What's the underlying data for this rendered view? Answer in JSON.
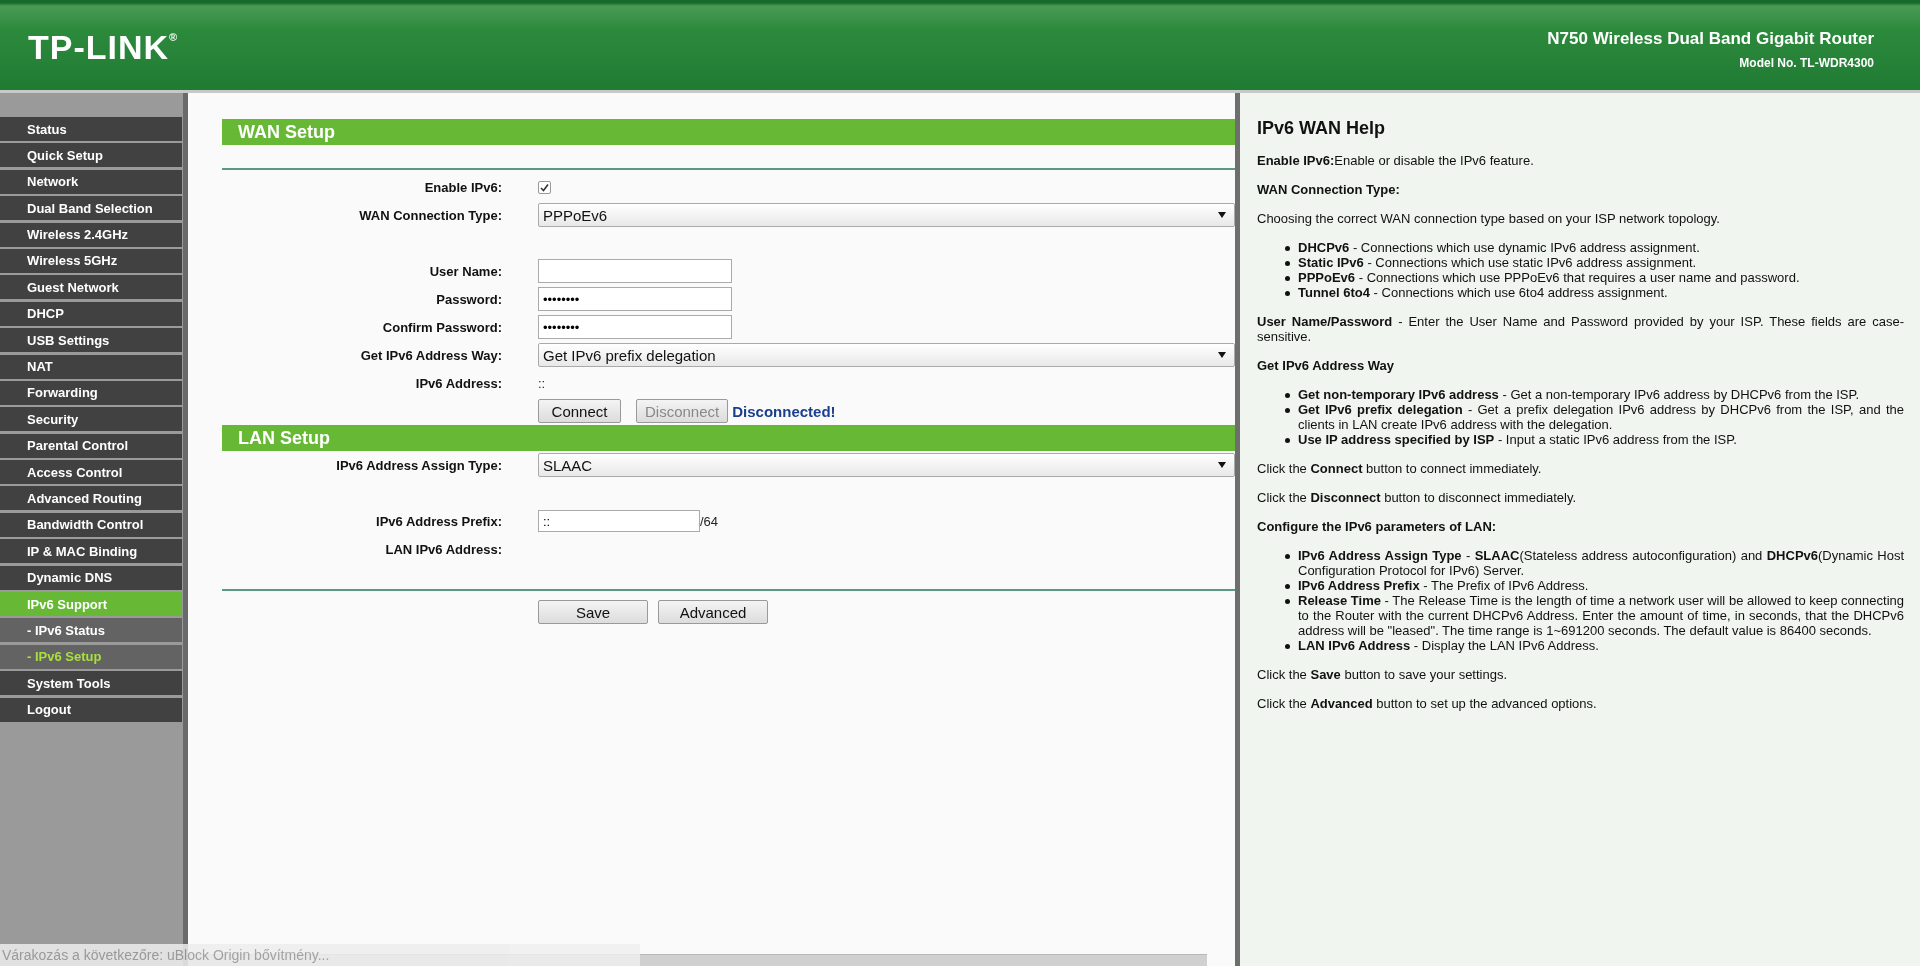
{
  "header": {
    "logo": "TP-LINK$^{®}$",
    "product": "N750 Wireless Dual Band Gigabit Router",
    "model": "Model No. TL-WDR4300"
  },
  "sidebar": {
    "items": [
      {
        "label": "Status",
        "kind": "main",
        "selected": false
      },
      {
        "label": "Quick Setup",
        "kind": "main",
        "selected": false
      },
      {
        "label": "Network",
        "kind": "main",
        "selected": false
      },
      {
        "label": "Dual Band Selection",
        "kind": "main",
        "selected": false
      },
      {
        "label": "Wireless 2.4GHz",
        "kind": "main",
        "selected": false
      },
      {
        "label": "Wireless 5GHz",
        "kind": "main",
        "selected": false
      },
      {
        "label": "Guest Network",
        "kind": "main",
        "selected": false
      },
      {
        "label": "DHCP",
        "kind": "main",
        "selected": false
      },
      {
        "label": "USB Settings",
        "kind": "main",
        "selected": false
      },
      {
        "label": "NAT",
        "kind": "main",
        "selected": false
      },
      {
        "label": "Forwarding",
        "kind": "main",
        "selected": false
      },
      {
        "label": "Security",
        "kind": "main",
        "selected": false
      },
      {
        "label": "Parental Control",
        "kind": "main",
        "selected": false
      },
      {
        "label": "Access Control",
        "kind": "main",
        "selected": false
      },
      {
        "label": "Advanced Routing",
        "kind": "main",
        "selected": false
      },
      {
        "label": "Bandwidth Control",
        "kind": "main",
        "selected": false
      },
      {
        "label": "IP & MAC Binding",
        "kind": "main",
        "selected": false
      },
      {
        "label": "Dynamic DNS",
        "kind": "main",
        "selected": false
      },
      {
        "label": "IPv6 Support",
        "kind": "main",
        "selected": true
      },
      {
        "label": "- IPv6 Status",
        "kind": "sub",
        "selected": false
      },
      {
        "label": "- IPv6 Setup",
        "kind": "sub",
        "selected": true
      },
      {
        "label": "System Tools",
        "kind": "main",
        "selected": false
      },
      {
        "label": "Logout",
        "kind": "main",
        "selected": false
      }
    ]
  },
  "wan": {
    "title": "WAN Setup",
    "groups": [
      [
        {
          "kind": "checkbox",
          "label": "Enable IPv6:",
          "checked": true
        },
        {
          "kind": "select",
          "label": "WAN Connection Type:",
          "value": "PPPoEv6"
        }
      ],
      [
        {
          "kind": "text",
          "label": "User Name:"
        },
        {
          "kind": "text",
          "label": "Password:",
          "value": "••••••••"
        },
        {
          "kind": "text",
          "label": "Confirm Password:",
          "value": "••••••••"
        },
        {
          "kind": "select",
          "label": "Get IPv6 Address Way:",
          "value": "Get IPv6 prefix delegation"
        },
        {
          "kind": "value",
          "label": "IPv6 Address:",
          "value": "::"
        },
        {
          "kind": "actions",
          "buttons": [
            {
              "label": "Connect",
              "disabled": false
            },
            {
              "label": "Disconnect",
              "disabled": true
            }
          ],
          "status": "Disconnected!"
        }
      ]
    ]
  },
  "lan": {
    "title": "LAN Setup",
    "groups": [
      [
        {
          "kind": "select",
          "label": "IPv6 Address Assign Type:",
          "value": "SLAAC"
        }
      ],
      [
        {
          "kind": "prefix",
          "label": "IPv6 Address Prefix:",
          "value": "::",
          "suffix": "/64"
        },
        {
          "kind": "value",
          "label": "LAN IPv6 Address:"
        }
      ]
    ]
  },
  "footer_buttons": [
    "Save",
    "Advanced"
  ],
  "help": {
    "title": "IPv6 WAN Help",
    "blocks": [
      {
        "kind": "para",
        "text": "**Enable IPv6:**Enable or disable the IPv6 feature."
      },
      {
        "kind": "heading",
        "text": "WAN Connection Type:"
      },
      {
        "kind": "para",
        "text": "Choosing the correct WAN connection type based on your ISP network topology."
      },
      {
        "kind": "list",
        "items": [
          "**DHCPv6** - Connections which use dynamic IPv6 address assignment.",
          "**Static IPv6** - Connections which use static IPv6 address assignment.",
          "**PPPoEv6** - Connections which use PPPoEv6 that requires a user name and password.",
          "**Tunnel 6to4** - Connections which use 6to4 address assignment."
        ]
      },
      {
        "kind": "para",
        "text": "**User Name/Password** - Enter the User Name and Password provided by your ISP. These fields are case-sensitive."
      },
      {
        "kind": "heading",
        "text": "Get IPv6 Address Way"
      },
      {
        "kind": "list",
        "items": [
          "**Get non-temporary IPv6 address** - Get a non-temporary IPv6 address by DHCPv6 from the ISP.",
          "**Get IPv6 prefix delegation** - Get a prefix delegation IPv6 address by DHCPv6 from the ISP, and the clients in LAN create IPv6 address with the delegation.",
          "**Use IP address specified by ISP** - Input a static IPv6 address from the ISP."
        ]
      },
      {
        "kind": "para",
        "text": "Click the **Connect** button to connect immediately."
      },
      {
        "kind": "para",
        "text": "Click the **Disconnect** button to disconnect immediately."
      },
      {
        "kind": "heading",
        "text": "Configure the IPv6 parameters of LAN:"
      },
      {
        "kind": "list",
        "items": [
          "**IPv6 Address Assign Type** - **SLAAC**(Stateless address autoconfiguration) and **DHCPv6**(Dynamic Host Configuration Protocol for IPv6) Server.",
          "**IPv6 Address Prefix** - The Prefix of IPv6 Address.",
          "**Release Time** - The Release Time is the length of time a network user will be allowed to keep connecting to the Router with the current DHCPv6 Address. Enter the amount of time, in seconds, that the DHCPv6 address will be \"leased\". The time range is 1~691200 seconds. The default value is 86400 seconds.",
          "**LAN IPv6 Address** - Display the LAN IPv6 Address."
        ]
      },
      {
        "kind": "para",
        "text": "Click the **Save** button to save your settings."
      },
      {
        "kind": "para",
        "text": "Click the **Advanced** button to set up the advanced options."
      }
    ]
  },
  "browser_status": "Várakozás a következőre: uBlock Origin bővítmény..."
}
